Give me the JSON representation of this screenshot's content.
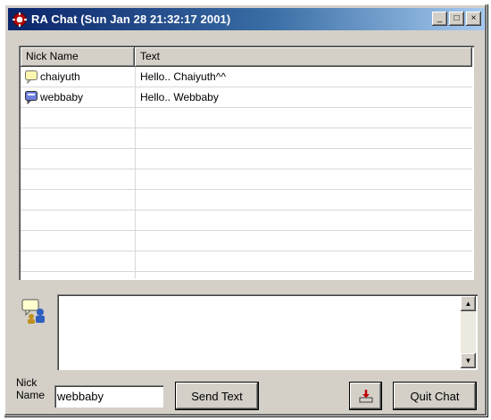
{
  "window": {
    "title": "RA Chat  (Sun Jan 28 21:32:17 2001)",
    "controls": {
      "minimize": "_",
      "maximize": "□",
      "close": "×"
    }
  },
  "chat_list": {
    "columns": [
      "Nick Name",
      "Text"
    ],
    "rows": [
      {
        "nick": "chaiyuth",
        "text": "Hello.. Chaiyuth^^",
        "icon": "speech-bubble-yellow-icon"
      },
      {
        "nick": "webbaby",
        "text": "Hello.. Webbaby",
        "icon": "speech-bubble-blue-icon"
      }
    ]
  },
  "message": {
    "value": ""
  },
  "nick": {
    "label_line1": "Nick",
    "label_line2": "Name",
    "value": "webbaby"
  },
  "buttons": {
    "send": "Send Text",
    "quit": "Quit Chat"
  },
  "colors": {
    "title_start": "#0a246a",
    "title_end": "#a6caf0",
    "face": "#d4d0c8"
  }
}
